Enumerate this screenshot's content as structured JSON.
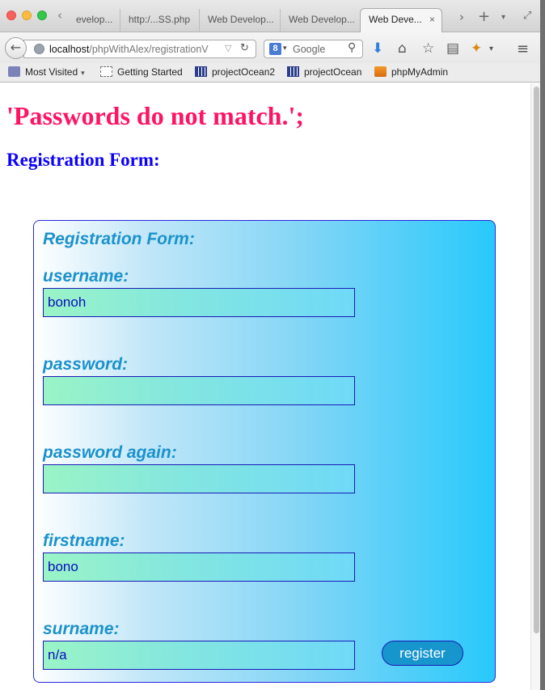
{
  "browser": {
    "tabs": [
      {
        "label": "evelop..."
      },
      {
        "label": "http:/...SS.php"
      },
      {
        "label": "Web Develop..."
      },
      {
        "label": "Web Develop..."
      },
      {
        "label": "Web Deve..."
      }
    ],
    "tab_close_glyph": "×",
    "new_tab_glyph": "+",
    "url": {
      "host": "localhost",
      "path": "/phpWithAlex/registrationV"
    },
    "search": {
      "engine_letter": "8",
      "placeholder": "Google"
    },
    "icons": [
      "back-icon",
      "globe-icon",
      "reload-icon",
      "search-icon",
      "download-icon",
      "home-icon",
      "star-icon",
      "reader-icon",
      "extension-icon",
      "menu-icon"
    ],
    "bookmarks": [
      {
        "label": "Most Visited"
      },
      {
        "label": "Getting Started"
      },
      {
        "label": "projectOcean2"
      },
      {
        "label": "projectOcean"
      },
      {
        "label": "phpMyAdmin"
      }
    ]
  },
  "page": {
    "error_message": "'Passwords do not match.';",
    "heading": "Registration Form:",
    "form": {
      "title": "Registration Form:",
      "fields": [
        {
          "label": "username:",
          "value": "bonoh"
        },
        {
          "label": "password:",
          "value": ""
        },
        {
          "label": "password again:",
          "value": ""
        },
        {
          "label": "firstname:",
          "value": "bono"
        },
        {
          "label": "surname:",
          "value": "n/a"
        }
      ],
      "submit_label": "register"
    }
  },
  "colors": {
    "error": "#ff1464",
    "heading": "#0b00ff",
    "form_label": "#1b92cc",
    "form_border": "#2727e0",
    "button": "#1696cc"
  }
}
